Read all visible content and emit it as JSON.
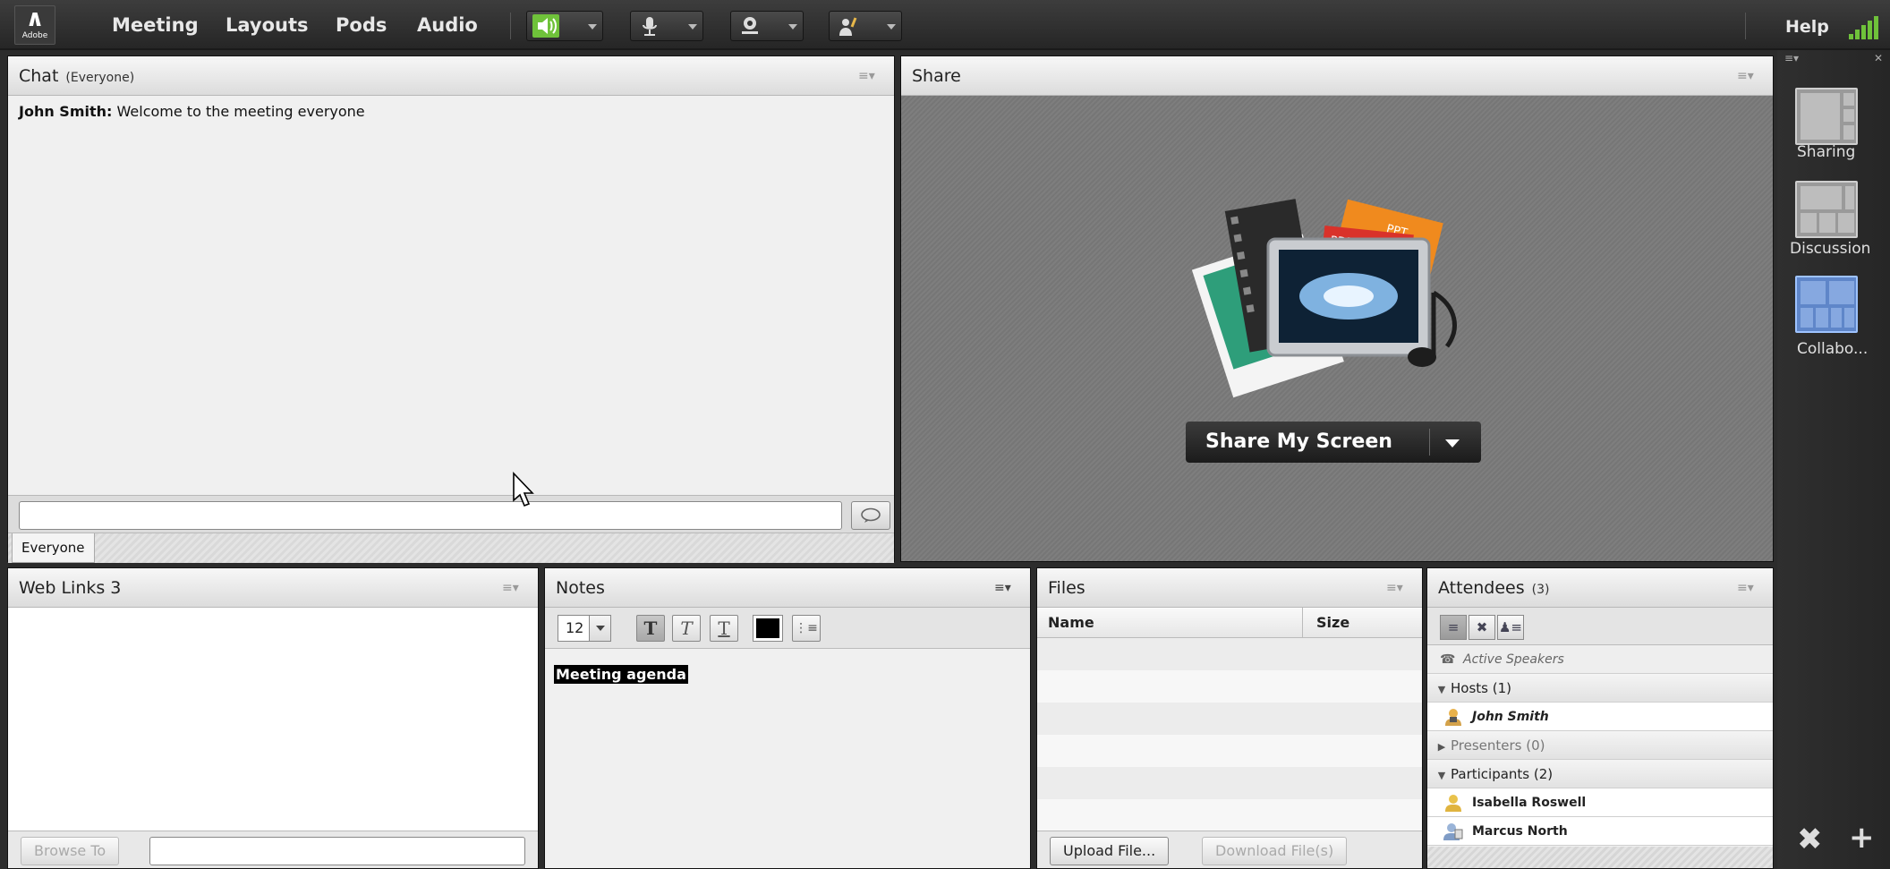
{
  "topbar": {
    "logo_text": "Adobe",
    "menus": [
      "Meeting",
      "Layouts",
      "Pods",
      "Audio"
    ],
    "help_label": "Help",
    "icons": [
      "speaker-icon",
      "microphone-icon",
      "webcam-icon",
      "raise-hand-icon"
    ],
    "speaker_color": "#6fc23a"
  },
  "chat": {
    "title": "Chat",
    "subtitle": "(Everyone)",
    "messages": [
      {
        "sender": "John Smith:",
        "text": "Welcome to the meeting everyone"
      }
    ],
    "input_value": "",
    "tab_label": "Everyone"
  },
  "share": {
    "title": "Share",
    "button_label": "Share My Screen",
    "file_badges": [
      "PPT",
      "PDF"
    ]
  },
  "layouts": {
    "items": [
      {
        "label": "Sharing",
        "active": false
      },
      {
        "label": "Discussion",
        "active": false
      },
      {
        "label": "Collabo...",
        "active": true
      }
    ]
  },
  "weblinks": {
    "title": "Web Links 3",
    "browse_label": "Browse To",
    "url_value": ""
  },
  "notes": {
    "title": "Notes",
    "font_size": "12",
    "text": "Meeting agenda",
    "text_color": "#000000"
  },
  "files": {
    "title": "Files",
    "columns": [
      "Name",
      "Size"
    ],
    "upload_label": "Upload File...",
    "download_label": "Download File(s)"
  },
  "attendees": {
    "title": "Attendees",
    "count": "(3)",
    "active_speakers_label": "Active Speakers",
    "groups": [
      {
        "label": "Hosts (1)",
        "expanded": true,
        "people": [
          "John Smith"
        ]
      },
      {
        "label": "Presenters (0)",
        "expanded": false,
        "people": []
      },
      {
        "label": "Participants (2)",
        "expanded": true,
        "people": [
          "Isabella Roswell",
          "Marcus North"
        ]
      }
    ]
  }
}
